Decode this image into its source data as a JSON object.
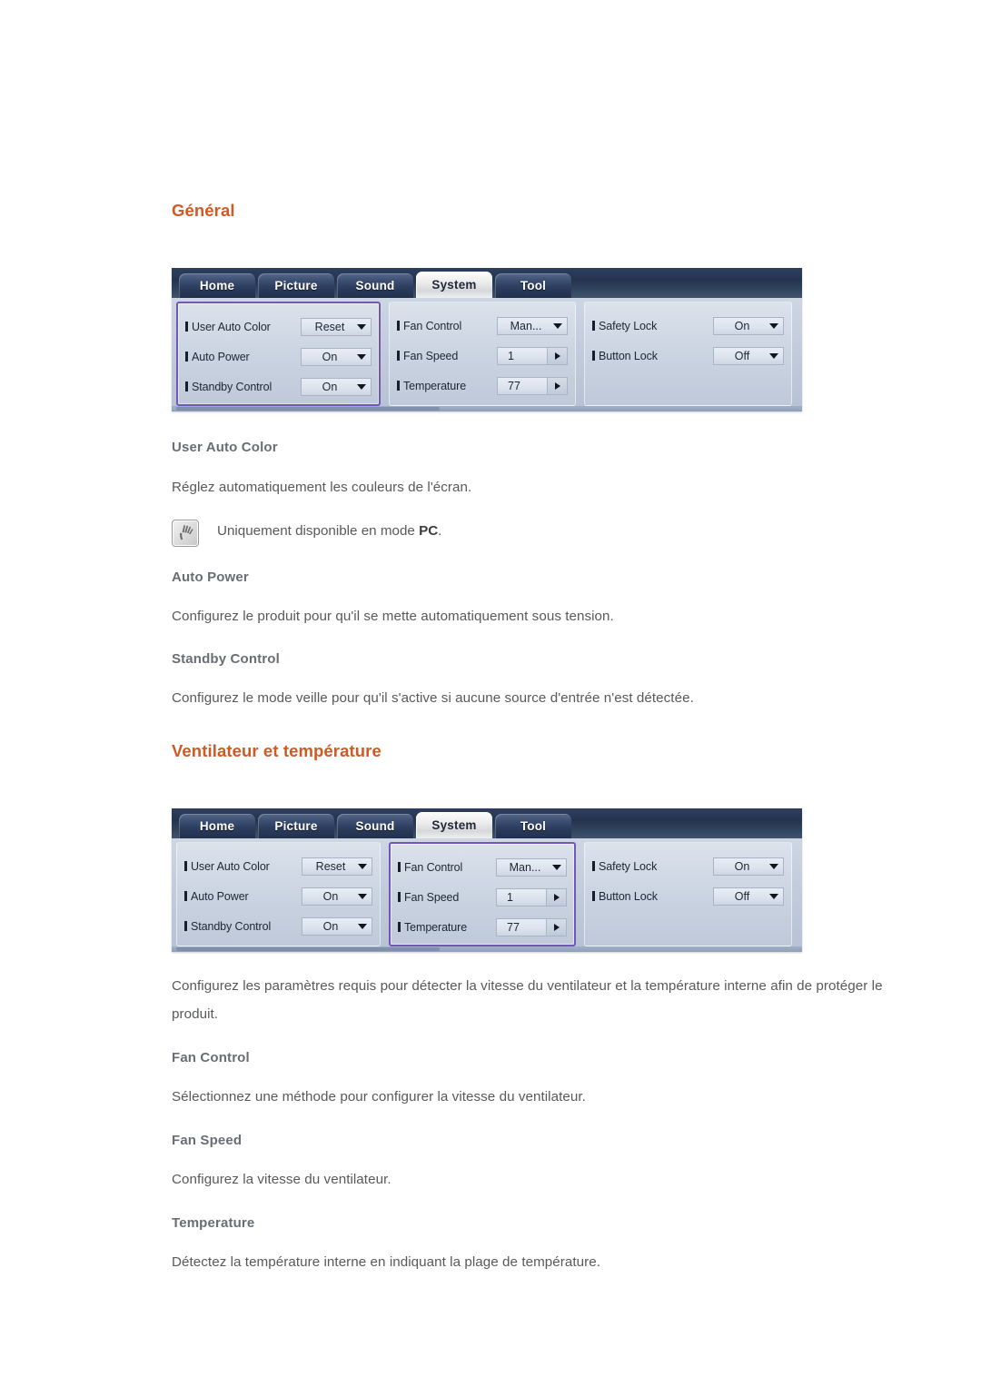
{
  "page": {
    "language": "fr",
    "accent_color": "#cf5a23",
    "highlight_color": "#7158b4"
  },
  "sections": [
    {
      "heading": "Général",
      "osd": {
        "tabs": [
          {
            "label": "Home",
            "active": false
          },
          {
            "label": "Picture",
            "active": false
          },
          {
            "label": "Sound",
            "active": false
          },
          {
            "label": "System",
            "active": true
          },
          {
            "label": "Tool",
            "active": false
          }
        ],
        "columns": [
          {
            "highlighted": true,
            "rows": [
              {
                "label": "User Auto Color",
                "value": "Reset",
                "control": "select"
              },
              {
                "label": "Auto Power",
                "value": "On",
                "control": "select"
              },
              {
                "label": "Standby Control",
                "value": "On",
                "control": "select"
              }
            ]
          },
          {
            "highlighted": false,
            "rows": [
              {
                "label": "Fan Control",
                "value": "Man...",
                "control": "select"
              },
              {
                "label": "Fan Speed",
                "value": "1",
                "control": "spinner"
              },
              {
                "label": "Temperature",
                "value": "77",
                "control": "spinner"
              }
            ]
          },
          {
            "highlighted": false,
            "rows": [
              {
                "label": "Safety Lock",
                "value": "On",
                "control": "select"
              },
              {
                "label": "Button Lock",
                "value": "Off",
                "control": "select"
              }
            ]
          }
        ]
      },
      "items": [
        {
          "title": "User Auto Color",
          "description": "Réglez automatiquement les couleurs de l'écran.",
          "note": {
            "icon": "note-pencil-icon",
            "text_before": "Uniquement disponible en mode ",
            "text_bold": "PC",
            "text_after": "."
          }
        },
        {
          "title": "Auto Power",
          "description": "Configurez le produit pour qu'il se mette automatiquement sous tension."
        },
        {
          "title": "Standby Control",
          "description": "Configurez le mode veille pour qu'il s'active si aucune source d'entrée n'est détectée."
        }
      ]
    },
    {
      "heading": "Ventilateur et température",
      "osd": {
        "tabs": [
          {
            "label": "Home",
            "active": false
          },
          {
            "label": "Picture",
            "active": false
          },
          {
            "label": "Sound",
            "active": false
          },
          {
            "label": "System",
            "active": true
          },
          {
            "label": "Tool",
            "active": false
          }
        ],
        "columns": [
          {
            "highlighted": false,
            "rows": [
              {
                "label": "User Auto Color",
                "value": "Reset",
                "control": "select"
              },
              {
                "label": "Auto Power",
                "value": "On",
                "control": "select"
              },
              {
                "label": "Standby Control",
                "value": "On",
                "control": "select"
              }
            ]
          },
          {
            "highlighted": true,
            "rows": [
              {
                "label": "Fan Control",
                "value": "Man...",
                "control": "select"
              },
              {
                "label": "Fan Speed",
                "value": "1",
                "control": "spinner"
              },
              {
                "label": "Temperature",
                "value": "77",
                "control": "spinner"
              }
            ]
          },
          {
            "highlighted": false,
            "rows": [
              {
                "label": "Safety Lock",
                "value": "On",
                "control": "select"
              },
              {
                "label": "Button Lock",
                "value": "Off",
                "control": "select"
              }
            ]
          }
        ]
      },
      "intro": "Configurez les paramètres requis pour détecter la vitesse du ventilateur et la température interne afin de protéger le produit.",
      "items": [
        {
          "title": "Fan Control",
          "description": "Sélectionnez une méthode pour configurer la vitesse du ventilateur."
        },
        {
          "title": "Fan Speed",
          "description": "Configurez la vitesse du ventilateur."
        },
        {
          "title": "Temperature",
          "description": "Détectez la température interne en indiquant la plage de température."
        }
      ]
    }
  ]
}
